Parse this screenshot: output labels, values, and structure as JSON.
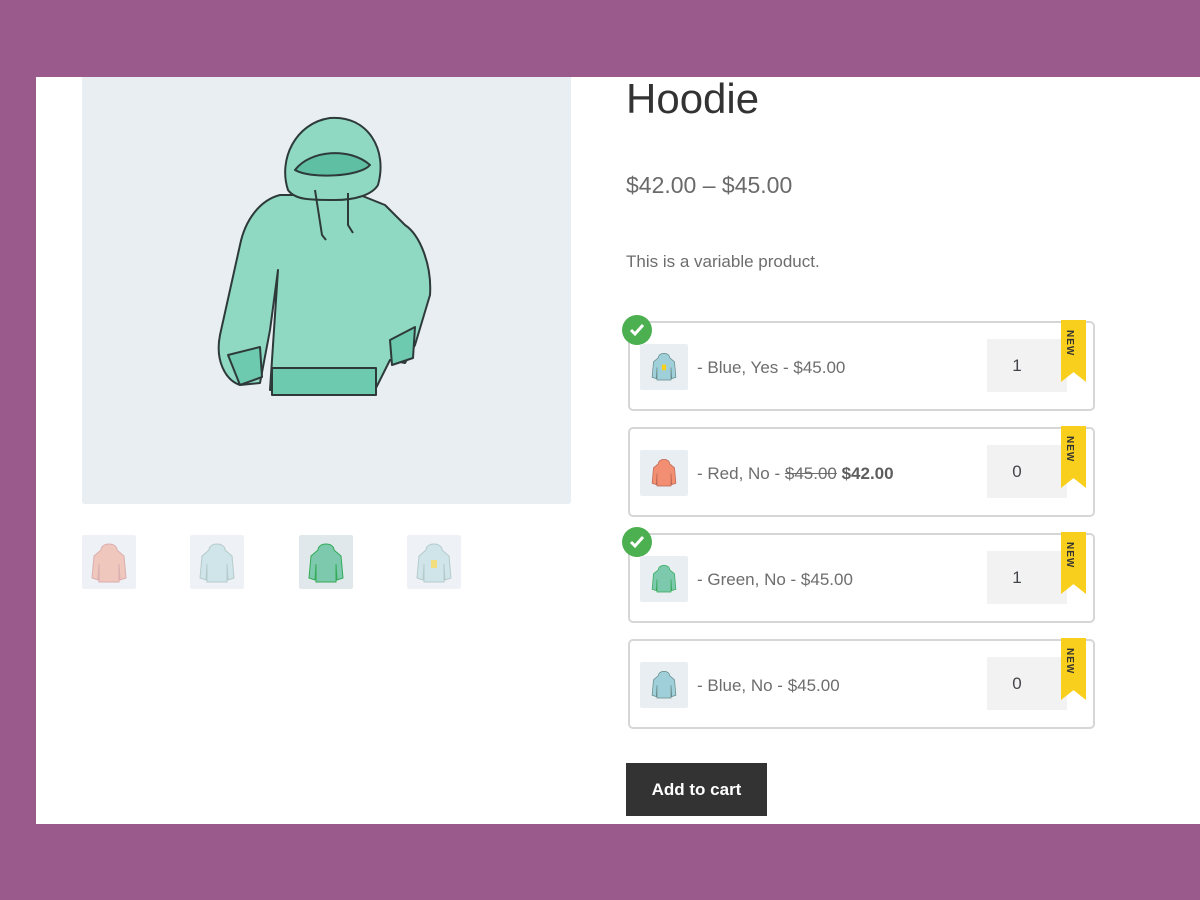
{
  "product": {
    "title": "Hoodie",
    "price_range": "$42.00 – $45.00",
    "description": "This is a variable product."
  },
  "gallery": {
    "main_image_icon": "hoodie-green-illustration",
    "thumbnails": [
      {
        "icon": "hoodie-red-thumbnail",
        "color": "#f0a48e"
      },
      {
        "icon": "hoodie-blue-thumbnail",
        "color": "#b8dcdf"
      },
      {
        "icon": "hoodie-green-thumbnail",
        "color": "#7dc9ad"
      },
      {
        "icon": "hoodie-blue-logo-thumbnail",
        "color": "#b8dcdf"
      }
    ]
  },
  "variations": [
    {
      "label": "- Blue, Yes - $45.00",
      "quantity": "1",
      "selected": true,
      "badge": "NEW",
      "color": "#9fd0da"
    },
    {
      "label_prefix": "- Red, No - ",
      "old_price": "$45.00",
      "sale_price": "$42.00",
      "quantity": "0",
      "selected": false,
      "badge": "NEW",
      "color": "#f28e72"
    },
    {
      "label": "- Green, No - $45.00",
      "quantity": "1",
      "selected": true,
      "badge": "NEW",
      "color": "#7dc9ad"
    },
    {
      "label": "- Blue, No - $45.00",
      "quantity": "0",
      "selected": false,
      "badge": "NEW",
      "color": "#9fd0da"
    }
  ],
  "actions": {
    "add_to_cart_label": "Add to cart"
  },
  "colors": {
    "frame_background": "#9a5b8c",
    "check_green": "#4caf50",
    "badge_yellow": "#f8cf1d",
    "button_dark": "#333333"
  }
}
